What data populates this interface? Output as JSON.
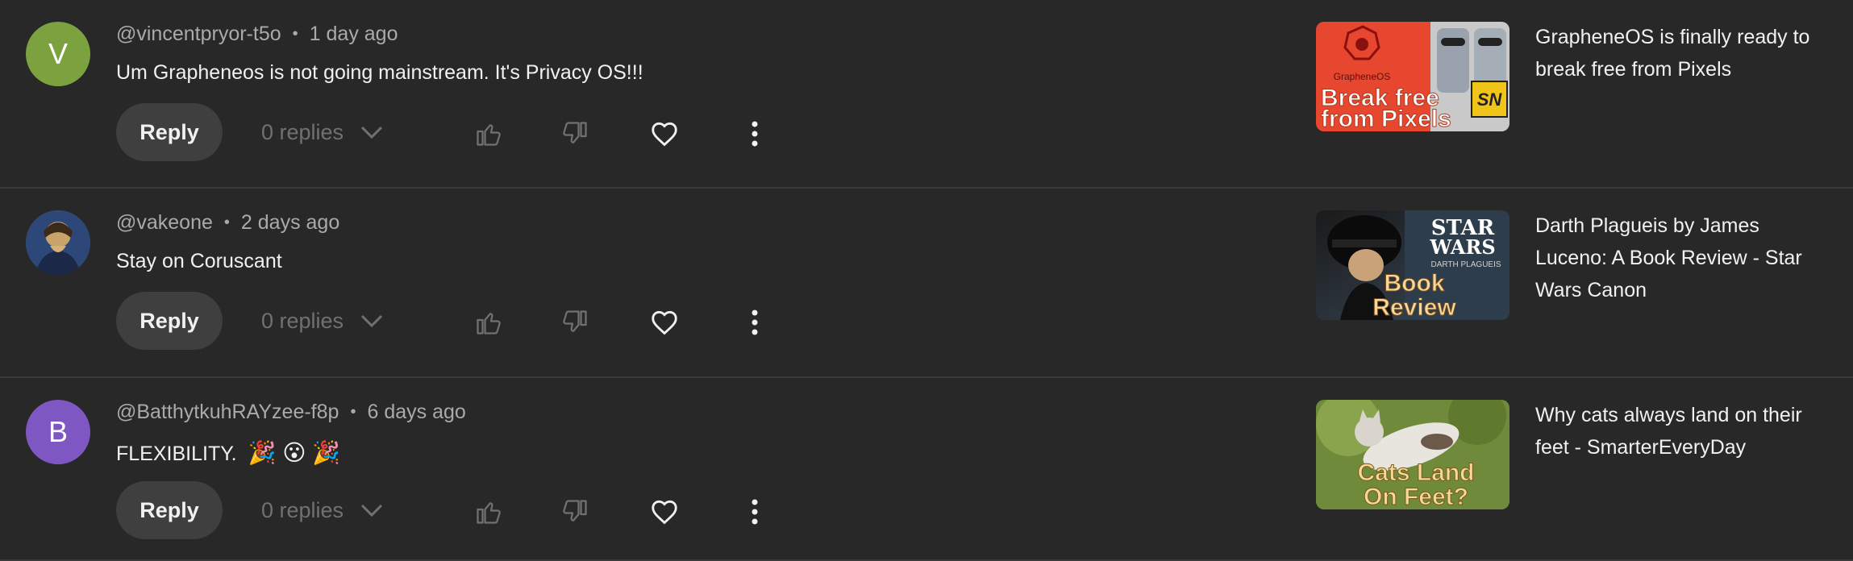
{
  "comments": [
    {
      "avatar_letter": "V",
      "avatar_color": "#7ba23f",
      "author": "@vincentpryor-t5o",
      "time": "1 day ago",
      "text": "Um Grapheneos is not going mainstream. It's Privacy OS!!!",
      "reply_label": "Reply",
      "replies": "0 replies",
      "video_title": "GrapheneOS is finally ready to break free from Pixels",
      "thumb_text": [
        "GrapheneOS",
        "Break free",
        "from Pixels",
        "SN"
      ]
    },
    {
      "avatar_letter": "",
      "avatar_color": "#3d5a86",
      "author": "@vakeone",
      "time": "2 days ago",
      "text": "Stay on Coruscant",
      "reply_label": "Reply",
      "replies": "0 replies",
      "video_title": "Darth Plagueis by James Luceno: A Book Review - Star Wars Canon",
      "thumb_text": [
        "STAR",
        "WARS",
        "DARTH PLAGUEIS",
        "Book",
        "Review"
      ]
    },
    {
      "avatar_letter": "B",
      "avatar_color": "#7e57c2",
      "author": "@BatthytkuhRAYzee-f8p",
      "time": "6 days ago",
      "text": "FLEXIBILITY.",
      "emoji": "🎉 😮 🎉",
      "reply_label": "Reply",
      "replies": "0 replies",
      "video_title": "Why cats always land on their feet - SmarterEveryDay",
      "thumb_text": [
        "Cats Land",
        "On Feet?"
      ]
    }
  ],
  "separator": "•",
  "icons": [
    "like-icon",
    "dislike-icon",
    "heart-icon",
    "more-vert-icon",
    "chevron-down-icon"
  ]
}
